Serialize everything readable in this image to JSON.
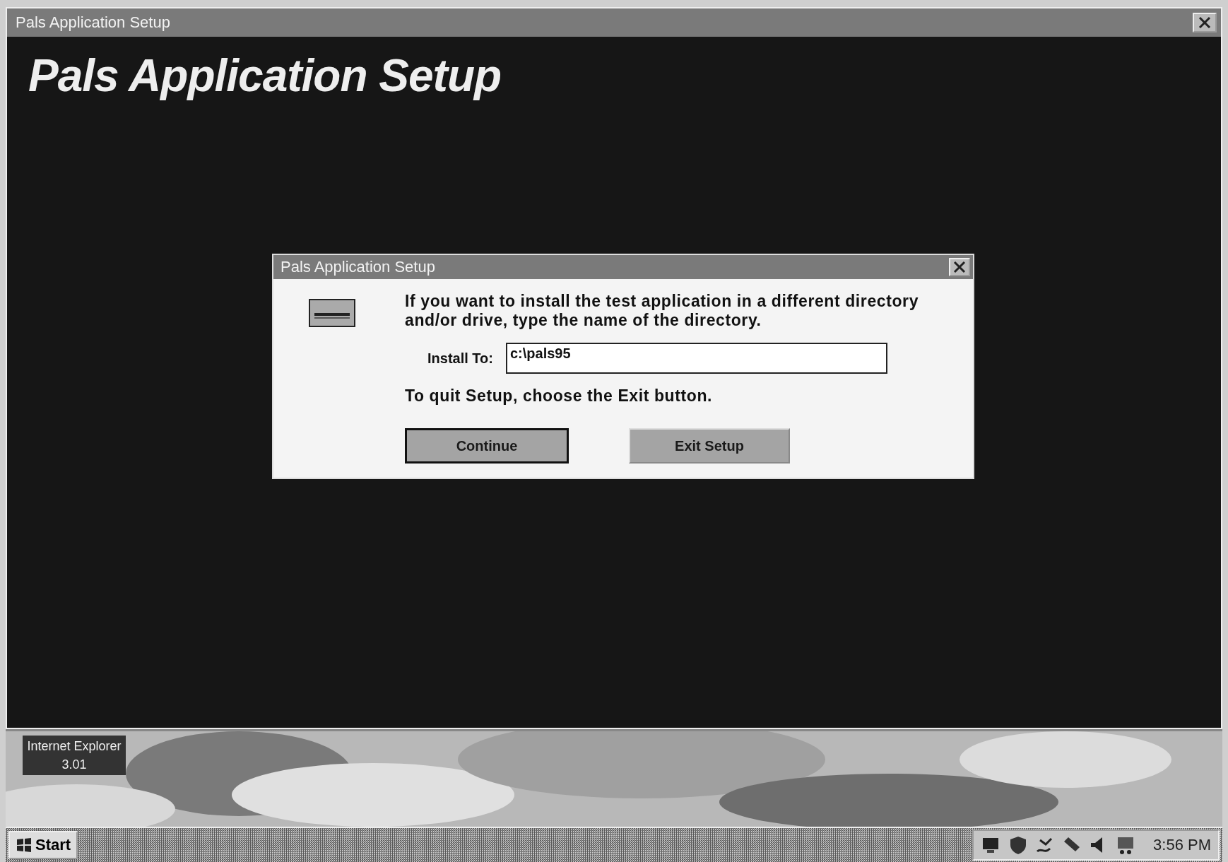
{
  "window": {
    "title": "Pals Application Setup"
  },
  "banner": {
    "title": "Pals Application Setup"
  },
  "dialog": {
    "title": "Pals Application Setup",
    "message": "If you want to install the test application in a different directory and/or drive, type the name of the directory.",
    "install_field": {
      "label": "Install To:",
      "value": "c:\\pals95"
    },
    "note": "To quit Setup, choose the Exit button.",
    "buttons": [
      {
        "label": "Continue",
        "default": true
      },
      {
        "label": "Exit Setup",
        "default": false
      }
    ]
  },
  "desktop": {
    "icons": [
      {
        "label": "Internet Explorer 3.01"
      }
    ]
  },
  "taskbar": {
    "start": "Start",
    "clock": "3:56 PM"
  }
}
